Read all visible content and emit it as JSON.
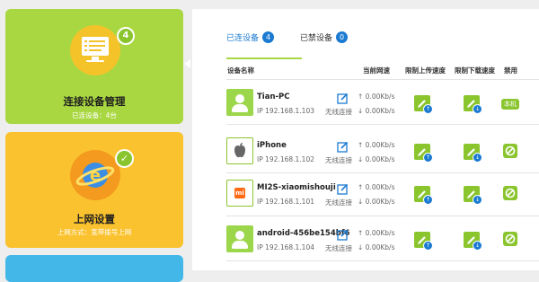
{
  "sidebar": {
    "devices_card": {
      "title": "连接设备管理",
      "subtitle": "已连设备：4台",
      "badge": "4"
    },
    "internet_card": {
      "title": "上网设置",
      "subtitle": "上网方式：宽带拨号上网",
      "logo_letter": "e",
      "check": "✓"
    }
  },
  "tabs": {
    "connected_label": "已连设备",
    "connected_count": "4",
    "blocked_label": "已禁设备",
    "blocked_count": "0"
  },
  "table": {
    "headers": {
      "name": "设备名称",
      "speed": "当前网速",
      "upload_limit": "限制上传速度",
      "download_limit": "限制下载速度",
      "ban": "禁用"
    },
    "rows": [
      {
        "name": "Tian-PC",
        "ip": "IP 192.168.1.103",
        "connection": "无线连接",
        "upload_speed": "↑ 0.00Kb/s",
        "download_speed": "↓ 0.00Kb/s",
        "status": "本机"
      },
      {
        "name": "iPhone",
        "ip": "IP 192.168.1.102",
        "connection": "无线连接",
        "upload_speed": "↑ 0.00Kb/s",
        "download_speed": "↓ 0.00Kb/s"
      },
      {
        "name": "MI2S-xiaomishouji",
        "ip": "IP 192.168.1.101",
        "connection": "无线连接",
        "upload_speed": "↑ 0.00Kb/s",
        "download_speed": "↓ 0.00Kb/s",
        "logo_text": "mi"
      },
      {
        "name": "android-456be154bf6",
        "ip": "IP 192.168.1.104",
        "connection": "无线连接",
        "upload_speed": "↑ 0.00Kb/s",
        "download_speed": "↓ 0.00Kb/s"
      }
    ]
  },
  "colors": {
    "devices_card": "#a9d741",
    "internet_card": "#fbc22f",
    "accent_blue": "#1b7ad1",
    "action_green": "#8ac52e"
  },
  "icons": {
    "devices_card": "monitor-icon",
    "internet_card": "internet-explorer-icon",
    "edit": "edit-icon",
    "upload_limit": "pencil-upload-icon",
    "download_limit": "pencil-download-icon",
    "block": "block-icon",
    "avatar_pc": "person-icon",
    "avatar_iphone": "apple-icon",
    "avatar_xiaomi": "xiaomi-icon",
    "avatar_android": "person-icon"
  }
}
